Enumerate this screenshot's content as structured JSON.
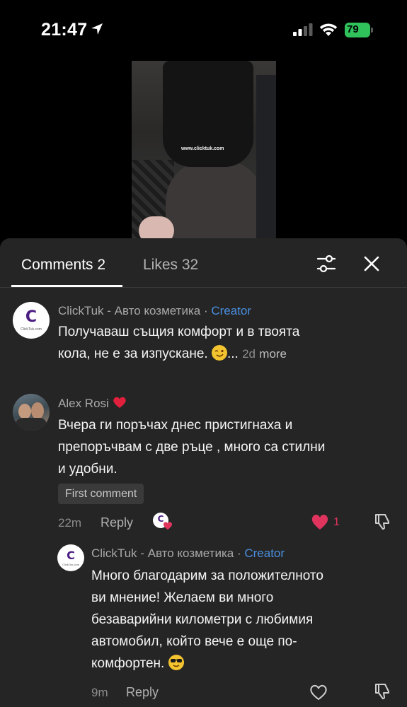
{
  "status_bar": {
    "time": "21:47",
    "battery": "79",
    "battery_color": "#30c35c"
  },
  "video": {
    "watermark": "www.clicktuk.com"
  },
  "panel": {
    "tabs": {
      "comments": "Comments 2",
      "likes": "Likes 32"
    },
    "icons": {
      "filter": "sliders-icon",
      "close": "close-icon"
    }
  },
  "comments": [
    {
      "avatar_letter": "C",
      "avatar_caption": "ClickTuk.com",
      "username": "ClickTuk - Авто козметика",
      "separator": " · ",
      "creator_label": "Creator",
      "text_line1": "Получаваш същия комфорт и в твоята",
      "text_line2": "кола, не е за изпускане.",
      "ellipsis": "...",
      "time": "2d",
      "more": "more"
    },
    {
      "username": "Alex Rosi",
      "text_line1": "Вчера ги поръчах днес пристигнаха и",
      "text_line2": "препоръчвам с две ръце , много са стилни",
      "text_line3": "и удобни.",
      "badge": "First comment",
      "time": "22m",
      "reply": "Reply",
      "like_count": "1",
      "creator_liked_letter": "C"
    }
  ],
  "reply": {
    "avatar_letter": "C",
    "avatar_caption": "ClickTuk.com",
    "username": "ClickTuk - Авто козметика",
    "separator": " · ",
    "creator_label": "Creator",
    "text_line1": "Много благодарим за положителното",
    "text_line2": "ви мнение! Желаем ви много",
    "text_line3": "безаварийни километри с любимия",
    "text_line4": "автомобил, който вече е още по-",
    "text_line5": "комфортен.",
    "time": "9m",
    "reply": "Reply"
  },
  "colors": {
    "creator": "#4a8fe0",
    "like": "#e0345e",
    "panel_bg": "#252525"
  }
}
